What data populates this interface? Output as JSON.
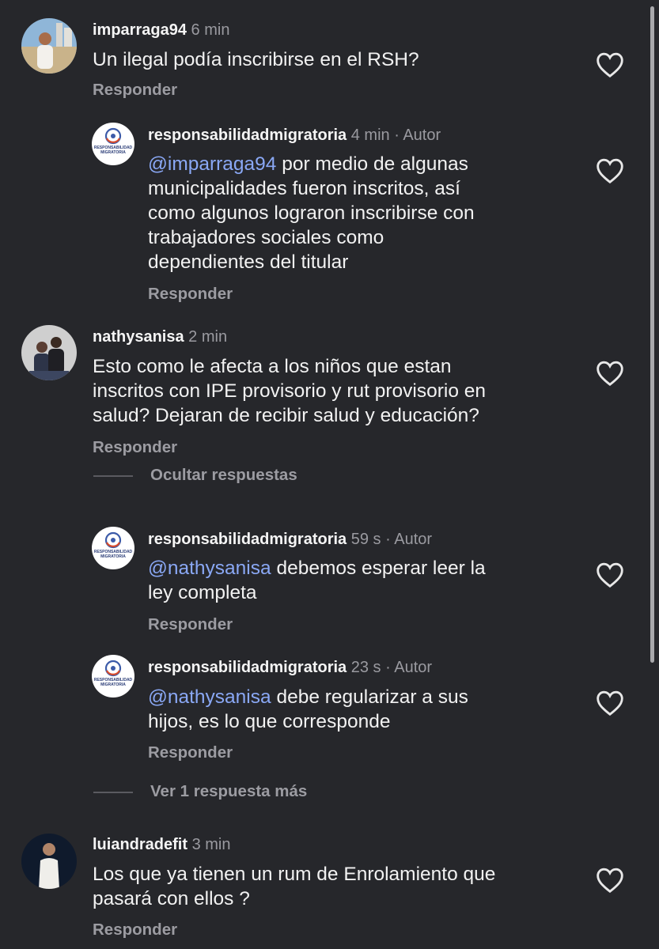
{
  "comments": [
    {
      "username": "imparraga94",
      "time": "6 min",
      "text": "Un ilegal podía inscribirse en el RSH?",
      "reply_label": "Responder"
    },
    {
      "username": "responsabilidadmigratoria",
      "time": "4 min",
      "author_tag": "Autor",
      "mention": "@imparraga94",
      "text": " por medio de algunas\nmunicipalidades fueron inscritos, así\ncomo algunos lograron inscribirse con\ntrabajadores sociales como\ndependientes del titular",
      "reply_label": "Responder"
    },
    {
      "username": "nathysanisa",
      "time": "2 min",
      "text": "Esto como le afecta a los niños que estan\ninscritos con IPE provisorio y rut provisorio en\nsalud? Dejaran de recibir salud y educación?",
      "reply_label": "Responder",
      "hide_replies_label": "Ocultar respuestas"
    },
    {
      "username": "responsabilidadmigratoria",
      "time": "59 s",
      "author_tag": "Autor",
      "mention": "@nathysanisa",
      "text": " debemos esperar leer la\nley completa",
      "reply_label": "Responder"
    },
    {
      "username": "responsabilidadmigratoria",
      "time": "23 s",
      "author_tag": "Autor",
      "mention": "@nathysanisa",
      "text": " debe regularizar a sus\nhijos, es lo que corresponde",
      "reply_label": "Responder",
      "more_replies_label": "Ver 1 respuesta más"
    },
    {
      "username": "luiandradefit",
      "time": "3 min",
      "text": "Los que ya tienen un rum  de Enrolamiento que\npasará con ellos ?",
      "reply_label": "Responder"
    }
  ],
  "logo": {
    "line1": "RESPONSABILIDAD",
    "line2": "MIGRATORIA"
  },
  "separator": "·",
  "colors": {
    "background": "#26272b",
    "mention": "#8aa8f5",
    "muted": "#9a9aa0"
  },
  "icons": {
    "like": "heart-icon"
  }
}
